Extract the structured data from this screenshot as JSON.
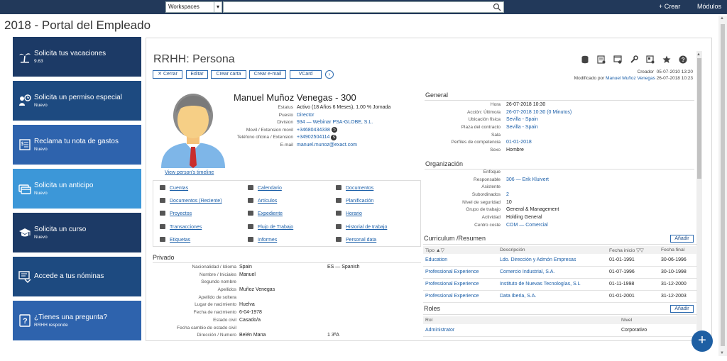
{
  "topbar": {
    "workspace_value": "Workspaces",
    "search_placeholder": "",
    "crear_label": "+ Crear",
    "modulos_label": "Módulos"
  },
  "page_title": "2018 - Portal del Empleado",
  "tiles": [
    {
      "title": "Solicita tus vacaciones",
      "subtitle": "9.63",
      "color": "#1c3a66",
      "icon": "palm-tree-icon"
    },
    {
      "title": "Solicita un permiso especial",
      "subtitle": "Nuevo",
      "color": "#1d4a80",
      "icon": "clock-person-icon"
    },
    {
      "title": "Reclama tu nota de gastos",
      "subtitle": "Nuevo",
      "color": "#2e63ad",
      "icon": "receipt-icon"
    },
    {
      "title": "Solicita un anticipo",
      "subtitle": "Nuevo",
      "color": "#3c97d8",
      "icon": "card-icon"
    },
    {
      "title": "Solicita un curso",
      "subtitle": "Nuevo",
      "color": "#1c3a66",
      "icon": "graduation-cap-icon"
    },
    {
      "title": "Accede a tus nóminas",
      "subtitle": "",
      "color": "#1d4a80",
      "icon": "payslip-icon"
    },
    {
      "title": "¿Tienes una pregunta?",
      "subtitle": "RRHH responde",
      "color": "#2e63ad",
      "icon": "question-icon"
    }
  ],
  "card": {
    "title": "RRHH: Persona",
    "buttons": [
      "✕ Cerrar",
      "Editar",
      "Crear carta",
      "Crear e-mail",
      "VCard"
    ],
    "next_label": "›",
    "meta": {
      "creador_label": "Creador",
      "creador_value": "05-07-2010 13:20",
      "modificado_label": "Modificado por",
      "modificado_user": "Manuel Muñoz Venegas",
      "modificado_date": "26-07-2018 10:23"
    },
    "timeline_link": "View person's timeline",
    "person_name": "Manuel Muñoz Venegas - 300",
    "fields": [
      {
        "label": "Estatus",
        "value": "Activo (18 Años 6 Meses), 1.00 % Jornada",
        "link": false,
        "skype": false
      },
      {
        "label": "Puesto",
        "value": "Director",
        "link": true,
        "skype": false
      },
      {
        "label": "Division",
        "value": "934 — Webinar PSA-GLOBE, S.L.",
        "link": true,
        "skype": false
      },
      {
        "label": "Movil / Extension movil",
        "value": "+34680434338",
        "link": true,
        "skype": true
      },
      {
        "label": "Teléfono oficina / Extension",
        "value": "+34902504114",
        "link": true,
        "skype": true
      },
      {
        "label": "E-mail",
        "value": "manuel.munoz@exact.com",
        "link": true,
        "skype": false
      }
    ],
    "quick_links": [
      [
        "Cuentas",
        "Calendario",
        "Documentos"
      ],
      [
        "Documentos (Reciente)",
        "Artículos",
        "Planificación"
      ],
      [
        "Proyectos",
        "Expediente",
        "Horario"
      ],
      [
        "Transacciones",
        "Flujo de Trabajo",
        "Historial de trabajo"
      ],
      [
        "Etiquetas",
        "Informes",
        "Personal data"
      ]
    ],
    "privado": {
      "title": "Privado",
      "rows": [
        {
          "label": "Nacionalidad / Idioma",
          "value": "Spain",
          "value2": "ES — Spanish"
        },
        {
          "label": "Nombre / Iniciales",
          "value": "Manuel",
          "value2": ""
        },
        {
          "label": "Segundo nombre",
          "value": "",
          "value2": ""
        },
        {
          "label": "Apellidos",
          "value": "Muñoz Venegas",
          "value2": ""
        },
        {
          "label": "Apellido de soltera",
          "value": "",
          "value2": ""
        },
        {
          "label": "Lugar de nacimiento",
          "value": "Huelva",
          "value2": ""
        },
        {
          "label": "Fecha de nacimiento",
          "value": "6-04-1978",
          "value2": ""
        },
        {
          "label": "Estado civil",
          "value": "Casado/a",
          "value2": ""
        },
        {
          "label": "Fecha cambio de estado civil",
          "value": "",
          "value2": ""
        },
        {
          "label": "Dirección / Numero",
          "value": "Belén Mana",
          "value2": "1   3ºA"
        }
      ]
    },
    "general": {
      "title": "General",
      "rows": [
        {
          "label": "Hora",
          "value": "26-07-2018 10:30",
          "link": false
        },
        {
          "label": "Acción: Último/a",
          "value": "26-07-2018 10:30 (0 Minutos)",
          "link": true
        },
        {
          "label": "Ubicación física",
          "value": "Sevilla - Spain",
          "link": true
        },
        {
          "label": "Plaza del contracto",
          "value": "Sevilla - Spain",
          "link": true
        },
        {
          "label": "Sala",
          "value": "",
          "link": false
        },
        {
          "label": "Perfiles de competencia",
          "value": "01-01-2018",
          "link": true
        },
        {
          "label": "Sexo",
          "value": "Hombre",
          "link": false
        }
      ]
    },
    "organizacion": {
      "title": "Organización",
      "rows": [
        {
          "label": "Enfoque",
          "value": "",
          "link": false
        },
        {
          "label": "Responsable",
          "value": "306 — Erik Kluivert",
          "link": true
        },
        {
          "label": "Asistente",
          "value": "",
          "link": false
        },
        {
          "label": "Subordinados",
          "value": "2",
          "link": true
        },
        {
          "label": "Nivel de seguridad",
          "value": "10",
          "link": false
        },
        {
          "label": "Grupo de trabajo",
          "value": "General & Management",
          "link": false
        },
        {
          "label": "Actividad",
          "value": "Holding General",
          "link": false
        },
        {
          "label": "Centro coste",
          "value": "COM — Comercial",
          "link": true
        }
      ]
    },
    "curriculum": {
      "title": "Curriculum /Resumen",
      "add_label": "Añadir",
      "headers": [
        "Tipo ▲▽",
        "Descripción",
        "Fecha inicio ▽▽",
        "Fecha final"
      ],
      "rows": [
        [
          "Education",
          "Ldo. Dirección y Admón Empresas",
          "01-01-1991",
          "30-06-1996"
        ],
        [
          "Professional Experience",
          "Comercio Industrial, S.A.",
          "01-07-1996",
          "30-10-1998"
        ],
        [
          "Professional Experience",
          "Instituto de Nuevas Tecnologías, S.L",
          "01-11-1998",
          "31-12-2000"
        ],
        [
          "Professional Experience",
          "Data Iberia, S.A.",
          "01-01-2001",
          "31-12-2003"
        ]
      ]
    },
    "roles": {
      "title": "Roles",
      "add_label": "Añadir",
      "headers": [
        "Rol",
        "Nivel"
      ],
      "rows": [
        [
          "Administrator",
          "Corporativo"
        ]
      ]
    }
  },
  "fab_label": "+"
}
